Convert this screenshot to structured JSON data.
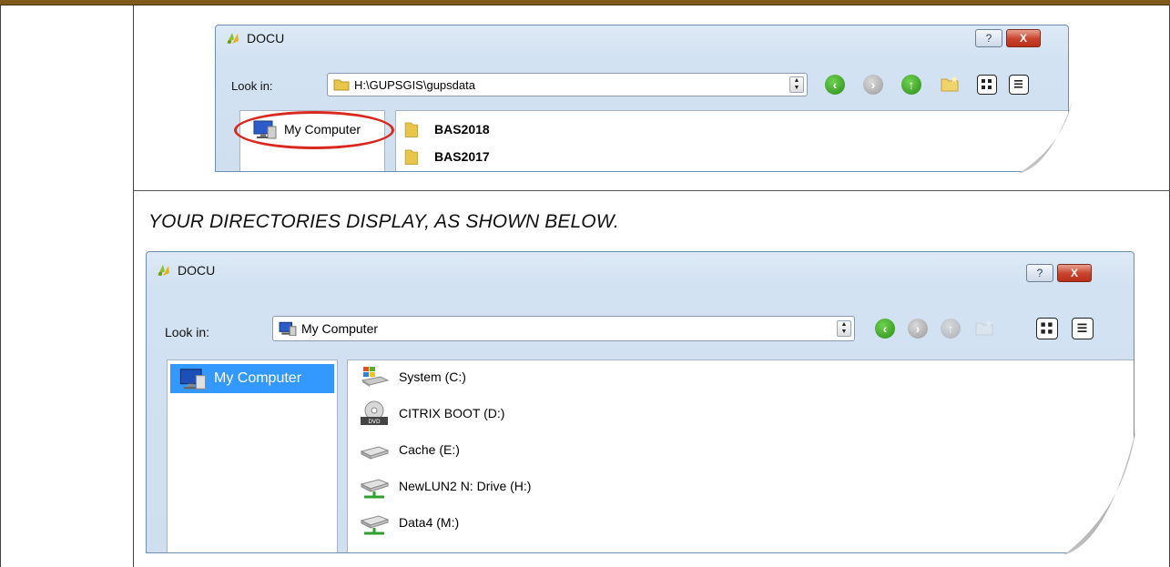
{
  "caption": "YOUR DIRECTORIES DISPLAY, AS SHOWN BELOW.",
  "dialog1": {
    "title": "DOCU",
    "help_label": "?",
    "close_label": "X",
    "lookin_label": "Look in:",
    "path": "H:\\GUPSGIS\\gupsdata",
    "sidebar_item": "My Computer",
    "files": [
      "BAS2018",
      "BAS2017"
    ]
  },
  "dialog2": {
    "title": "DOCU",
    "help_label": "?",
    "close_label": "X",
    "lookin_label": "Look in:",
    "path": "My Computer",
    "sidebar_item": "My Computer",
    "drives": [
      {
        "label": "System (C:)",
        "icon": "windows-drive-icon"
      },
      {
        "label": "CITRIX BOOT (D:)",
        "icon": "dvd-rom-icon"
      },
      {
        "label": "Cache (E:)",
        "icon": "hard-drive-icon"
      },
      {
        "label": "NewLUN2 N: Drive (H:)",
        "icon": "network-drive-icon"
      },
      {
        "label": "Data4 (M:)",
        "icon": "network-drive-icon"
      }
    ]
  },
  "colors": {
    "header_bar": "#7f5a1c",
    "selection": "#3399ff",
    "highlight_ellipse": "#d9281e",
    "nav_green": "#2a8a1a"
  }
}
